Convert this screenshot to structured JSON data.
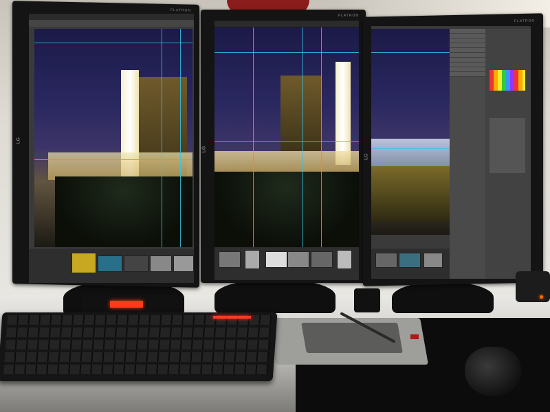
{
  "scene": {
    "description_items": [
      "three-monitors",
      "keyboard",
      "pen-tablet",
      "mouse",
      "mousepad"
    ]
  },
  "monitors": {
    "left": {
      "brand_top": "FLATRON",
      "brand_side": "LG"
    },
    "middle": {
      "brand_top": "FLATRON",
      "brand_side": "LG"
    },
    "right": {
      "brand_top": "FLATRON",
      "brand_side": "LG"
    }
  },
  "colors": {
    "guides": "#35c3e8",
    "led_red": "#ff3b1f",
    "sky": "#1b1a47"
  }
}
